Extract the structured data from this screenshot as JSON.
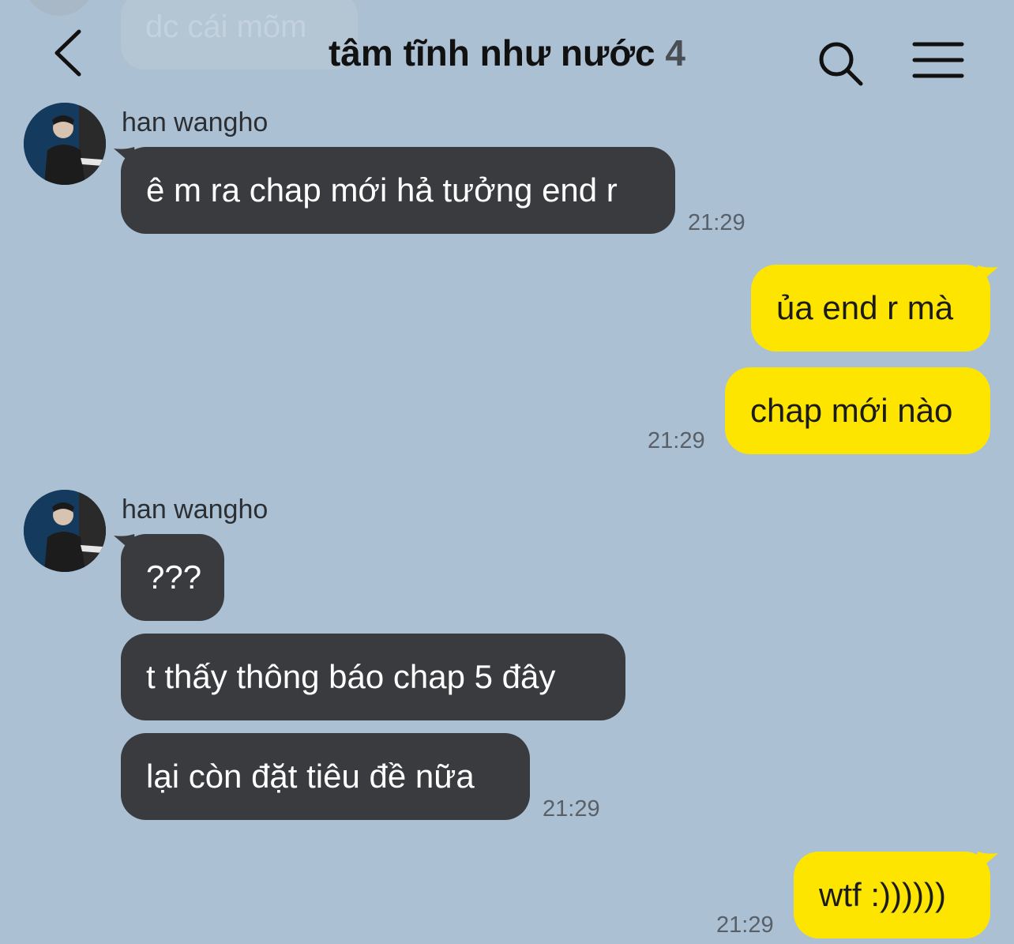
{
  "previous_message": {
    "text": "dc cái mõm"
  },
  "header": {
    "title": "tâm tĩnh như nước",
    "member_count": "4"
  },
  "messages": [
    {
      "side": "in",
      "sender": "han wangho",
      "text": "ê m ra chap mới hả tưởng end r",
      "time": "21:29"
    },
    {
      "side": "out",
      "text": "ủa end r mà"
    },
    {
      "side": "out",
      "text": "chap mới nào",
      "time": "21:29"
    },
    {
      "side": "in",
      "sender": "han wangho",
      "text": "???"
    },
    {
      "side": "in",
      "text": "t thấy thông báo chap 5 đây"
    },
    {
      "side": "in",
      "text": "lại còn đặt tiêu đề nữa",
      "time": "21:29"
    },
    {
      "side": "out",
      "text": "wtf :))))))",
      "time": "21:29"
    }
  ],
  "colors": {
    "background": "#abc0d3",
    "incoming_bubble": "#3a3b3f",
    "outgoing_bubble": "#fee500"
  }
}
